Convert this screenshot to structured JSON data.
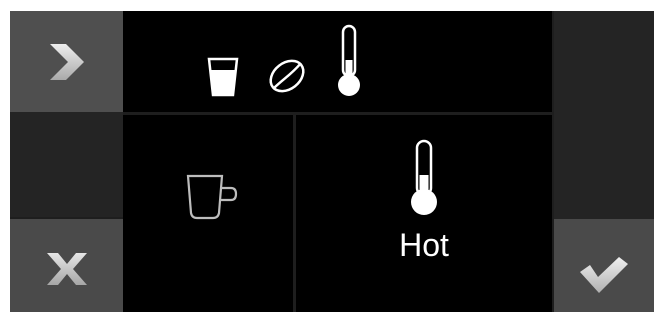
{
  "navigation": {
    "next_icon": "chevron-right-icon",
    "cancel_icon": "x-icon",
    "confirm_icon": "checkmark-icon"
  },
  "status_bar": {
    "icons": [
      "water-glass-icon",
      "coffee-bean-icon",
      "thermometer-icon"
    ]
  },
  "options": {
    "cup": {
      "icon": "cup-icon"
    },
    "temperature": {
      "icon": "thermometer-icon",
      "label": "Hot"
    }
  },
  "colors": {
    "background": "#000000",
    "button": "#4a4a4a",
    "side_panel": "#242424",
    "icon_white": "#ffffff",
    "icon_grey": "#bdbdbd"
  }
}
